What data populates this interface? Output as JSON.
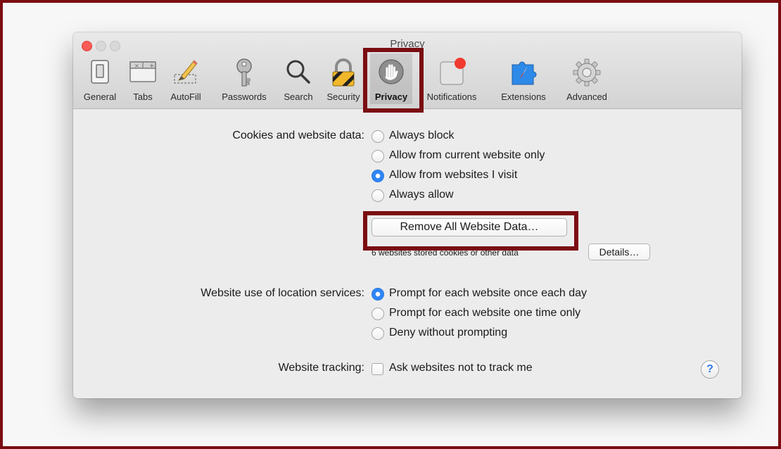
{
  "window": {
    "title": "Privacy"
  },
  "toolbar": {
    "items": [
      {
        "label": "General"
      },
      {
        "label": "Tabs"
      },
      {
        "label": "AutoFill"
      },
      {
        "label": "Passwords"
      },
      {
        "label": "Search"
      },
      {
        "label": "Security"
      },
      {
        "label": "Privacy"
      },
      {
        "label": "Notifications"
      },
      {
        "label": "Extensions"
      },
      {
        "label": "Advanced"
      }
    ],
    "selected": "Privacy"
  },
  "cookies": {
    "label": "Cookies and website data:",
    "options": [
      {
        "label": "Always block",
        "selected": false
      },
      {
        "label": "Allow from current website only",
        "selected": false
      },
      {
        "label": "Allow from websites I visit",
        "selected": true
      },
      {
        "label": "Always allow",
        "selected": false
      }
    ],
    "remove_button": "Remove All Website Data…",
    "stored_text": "6 websites stored cookies or other data",
    "details_button": "Details…"
  },
  "location": {
    "label": "Website use of location services:",
    "options": [
      {
        "label": "Prompt for each website once each day",
        "selected": true
      },
      {
        "label": "Prompt for each website one time only",
        "selected": false
      },
      {
        "label": "Deny without prompting",
        "selected": false
      }
    ]
  },
  "tracking": {
    "label": "Website tracking:",
    "checkbox_label": "Ask websites not to track me",
    "checked": false
  },
  "help": {
    "glyph": "?"
  },
  "colors": {
    "highlight": "#7a0d12",
    "accent_blue": "#2f86f6",
    "notification_red": "#f03a2e"
  }
}
